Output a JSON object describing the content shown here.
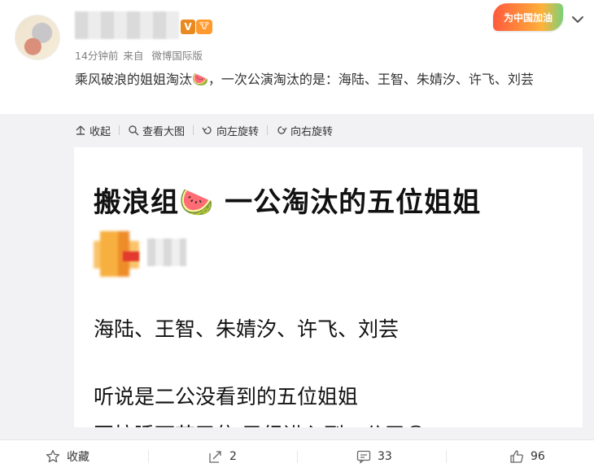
{
  "post": {
    "meta": {
      "time": "14分钟前",
      "source_prefix": "来自",
      "source": "微博国际版"
    },
    "text": "乘风破浪的姐姐淘汰🍉，一次公演淘汰的是：海陆、王智、朱婧汐、许飞、刘芸",
    "verified_mark": "V",
    "fan_badge": "🐮",
    "promo_badge": "为中国加油"
  },
  "toolbar": {
    "collapse": "收起",
    "view_large": "查看大图",
    "rotate_left": "向左旋转",
    "rotate_right": "向右旋转"
  },
  "image": {
    "title": "搬浪组🍉 一公淘汰的五位姐姐",
    "line1": "海陆、王智、朱婧汐、许飞、刘芸",
    "line2": "听说是二公没看到的五位姐姐",
    "line3": "再拉睡下节又依 已经进入到二公了😊"
  },
  "actions": {
    "favorite": "收藏",
    "repost_count": "2",
    "comment_count": "33",
    "like_count": "96"
  },
  "icons": [
    "collapse-icon",
    "zoom-icon",
    "rotate-left-icon",
    "rotate-right-icon",
    "star-icon",
    "repost-icon",
    "comment-icon",
    "like-icon",
    "chevron-down-icon"
  ]
}
